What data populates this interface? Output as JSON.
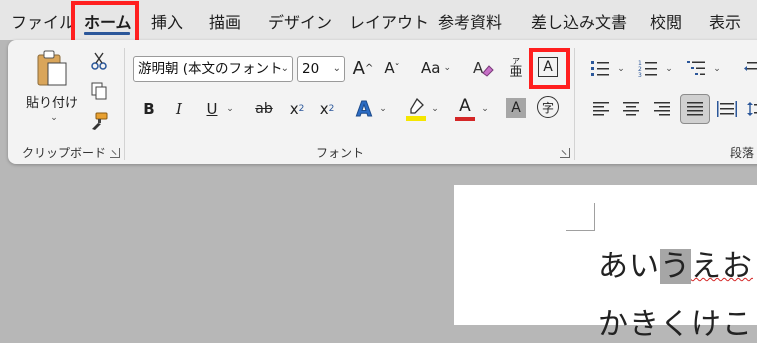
{
  "tabs": [
    "ファイル",
    "ホーム",
    "挿入",
    "描画",
    "デザイン",
    "レイアウト",
    "参考資料",
    "差し込み文書",
    "校閲",
    "表示"
  ],
  "active_tab": "ホーム",
  "clipboard": {
    "paste_label": "貼り付け",
    "group_label": "クリップボード"
  },
  "font": {
    "font_name": "游明朝 (本文のフォント",
    "font_size": "20",
    "group_label": "フォント",
    "grow_label": "A",
    "shrink_label": "A",
    "case_label": "Aa",
    "ruby_top": "ア",
    "ruby_bottom": "亜",
    "border_label": "A",
    "bold": "B",
    "italic": "I",
    "underline": "U",
    "strike": "ab",
    "subscript": "x",
    "subscript_mark": "2",
    "superscript": "x",
    "superscript_mark": "2",
    "effects": "A",
    "font_color": "A",
    "shading": "A",
    "enclose": "字"
  },
  "paragraph": {
    "group_label": "段落"
  },
  "colors": {
    "accent": "#2b579a",
    "highlight_box": "#ff1f1f",
    "text_highlight": "#f5e600",
    "font_color": "#d42626",
    "selection": "#a6a6a6"
  },
  "document": {
    "line1": [
      "あい",
      "う",
      "えお"
    ],
    "line2": "かきくけこ"
  }
}
